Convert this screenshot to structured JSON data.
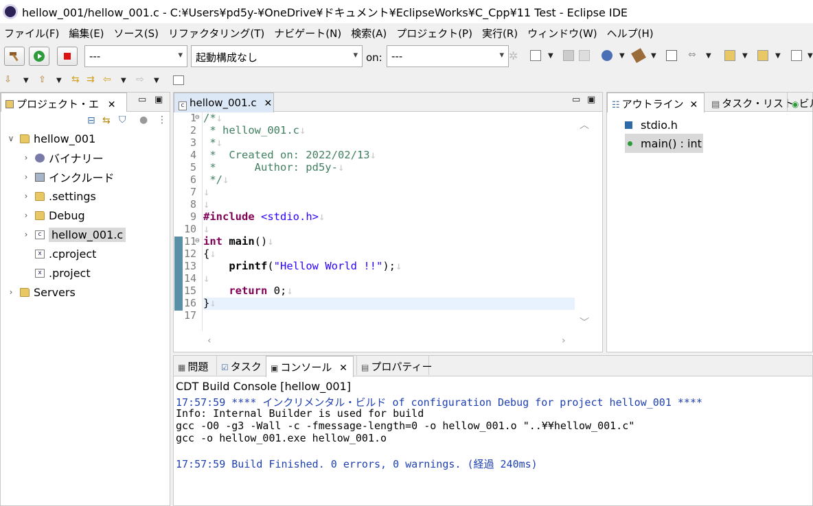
{
  "window": {
    "title": "hellow_001/hellow_001.c - C:¥Users¥pd5y-¥OneDrive¥ドキュメント¥EclipseWorks¥C_Cpp¥11 Test - Eclipse IDE"
  },
  "menu": [
    "ファイル(F)",
    "編集(E)",
    "ソース(S)",
    "リファクタリング(T)",
    "ナビゲート(N)",
    "検索(A)",
    "プロジェクト(P)",
    "実行(R)",
    "ウィンドウ(W)",
    "ヘルプ(H)"
  ],
  "toolbar": {
    "mode_combo": "---",
    "launch_combo": "起動構成なし",
    "on_label": "on:",
    "target_combo": "---"
  },
  "project_explorer": {
    "tab_label": "プロジェクト・エ",
    "tree": [
      {
        "label": "hellow_001",
        "level": 0,
        "expanded": true,
        "icon": "project-icon"
      },
      {
        "label": "バイナリー",
        "level": 1,
        "icon": "binaries-icon"
      },
      {
        "label": "インクルード",
        "level": 1,
        "icon": "includes-icon"
      },
      {
        "label": ".settings",
        "level": 1,
        "icon": "folder-icon"
      },
      {
        "label": "Debug",
        "level": 1,
        "icon": "folder-icon"
      },
      {
        "label": "hellow_001.c",
        "level": 1,
        "icon": "c-file-icon",
        "selected": true
      },
      {
        "label": ".cproject",
        "level": 1,
        "icon": "xml-file-icon",
        "leaf": true
      },
      {
        "label": ".project",
        "level": 1,
        "icon": "xml-file-icon",
        "leaf": true
      },
      {
        "label": "Servers",
        "level": 0,
        "expanded": false,
        "icon": "project-icon"
      }
    ]
  },
  "editor": {
    "tab_label": "hellow_001.c",
    "lines": [
      {
        "n": "1",
        "fold": "⊖",
        "text": "/*¶"
      },
      {
        "n": "2",
        "text": " * hellow_001.c¶"
      },
      {
        "n": "3",
        "text": " *¶"
      },
      {
        "n": "4",
        "text": " *  Created on: 2022/02/13¶"
      },
      {
        "n": "5",
        "text": " *      Author: pd5y-¶"
      },
      {
        "n": "6",
        "text": " */¶"
      },
      {
        "n": "7",
        "text": "¶"
      },
      {
        "n": "8",
        "text": "¶"
      },
      {
        "n": "9",
        "text": "#include <stdio.h>¶"
      },
      {
        "n": "10",
        "text": "¶"
      },
      {
        "n": "11",
        "fold": "⊖",
        "text": "int main()¶"
      },
      {
        "n": "12",
        "text": "{¶"
      },
      {
        "n": "13",
        "text": "    printf(\"Hellow World !!\");¶"
      },
      {
        "n": "14",
        "text": "¶"
      },
      {
        "n": "15",
        "text": "    return 0;¶"
      },
      {
        "n": "16",
        "text": "}¶"
      },
      {
        "n": "17",
        "text": ""
      }
    ]
  },
  "outline": {
    "tab_label": "アウトライン",
    "tasklist_label": "タスク・リスト",
    "extra_label": "ビル",
    "items": [
      {
        "label": "stdio.h",
        "icon": "include-icon"
      },
      {
        "label": "main() : int",
        "icon": "function-icon",
        "selected": true
      }
    ]
  },
  "bottom": {
    "tabs": [
      "問題",
      "タスク",
      "コンソール",
      "プロパティー"
    ],
    "console_header": "CDT Build Console [hellow_001]",
    "console_lines": [
      {
        "text": "17:57:59 **** インクリメンタル・ビルド of configuration Debug for project hellow_001 ****",
        "color": "#1e3fb0"
      },
      {
        "text": "Info: Internal Builder is used for build",
        "color": "#000000"
      },
      {
        "text": "gcc -O0 -g3 -Wall -c -fmessage-length=0 -o hellow_001.o \"..¥¥hellow_001.c\"",
        "color": "#000000"
      },
      {
        "text": "gcc -o hellow_001.exe hellow_001.o",
        "color": "#000000"
      },
      {
        "text": "",
        "color": "#000000"
      },
      {
        "text": "17:57:59 Build Finished. 0 errors, 0 warnings. (経過 240ms)",
        "color": "#1e3fb0"
      }
    ]
  }
}
